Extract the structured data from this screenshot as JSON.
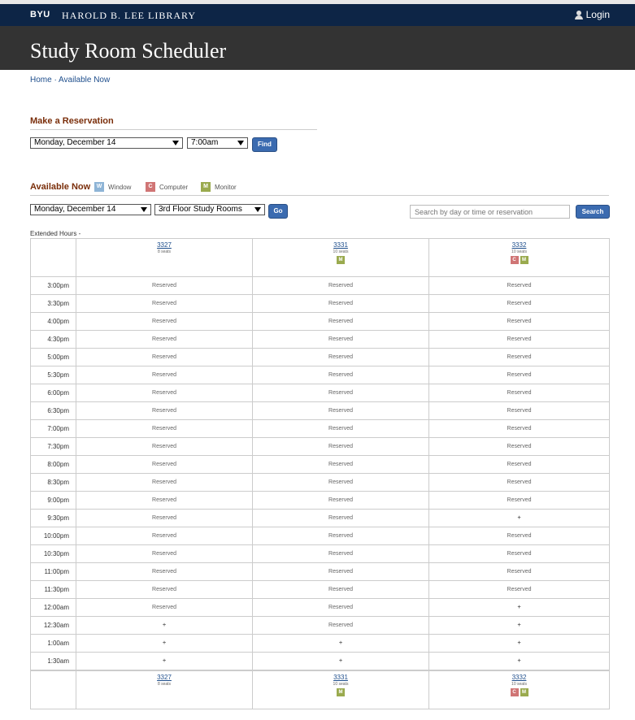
{
  "header": {
    "brand": "BYU",
    "library": "HAROLD B. LEE LIBRARY",
    "login": "Login"
  },
  "title": "Study Room Scheduler",
  "breadcrumb": {
    "home": "Home",
    "sep": " · ",
    "current": "Available Now"
  },
  "reservation": {
    "heading": "Make a Reservation",
    "date": "Monday, December 14",
    "time": "7:00am",
    "find": "Find"
  },
  "available": {
    "heading": "Available Now",
    "legend": [
      {
        "code": "W",
        "label": "Window",
        "color": "#8eb4d6"
      },
      {
        "code": "C",
        "label": "Computer",
        "color": "#d07575"
      },
      {
        "code": "M",
        "label": "Monitor",
        "color": "#9aaa4e"
      }
    ],
    "date": "Monday, December 14",
    "location": "3rd Floor Study Rooms",
    "go": "Go",
    "search_placeholder": "Search by day or time or reservation",
    "search": "Search",
    "extended": "Extended Hours -"
  },
  "rooms": [
    {
      "number": "3327",
      "seats": "8 seats",
      "features": []
    },
    {
      "number": "3331",
      "seats": "10 seats",
      "features": [
        "M"
      ]
    },
    {
      "number": "3332",
      "seats": "10 seats",
      "features": [
        "C",
        "M"
      ]
    }
  ],
  "slots": [
    {
      "time": "3:00pm",
      "cells": [
        "Reserved",
        "Reserved",
        "Reserved"
      ]
    },
    {
      "time": "3:30pm",
      "cells": [
        "Reserved",
        "Reserved",
        "Reserved"
      ]
    },
    {
      "time": "4:00pm",
      "cells": [
        "Reserved",
        "Reserved",
        "Reserved"
      ]
    },
    {
      "time": "4:30pm",
      "cells": [
        "Reserved",
        "Reserved",
        "Reserved"
      ]
    },
    {
      "time": "5:00pm",
      "cells": [
        "Reserved",
        "Reserved",
        "Reserved"
      ]
    },
    {
      "time": "5:30pm",
      "cells": [
        "Reserved",
        "Reserved",
        "Reserved"
      ]
    },
    {
      "time": "6:00pm",
      "cells": [
        "Reserved",
        "Reserved",
        "Reserved"
      ]
    },
    {
      "time": "6:30pm",
      "cells": [
        "Reserved",
        "Reserved",
        "Reserved"
      ]
    },
    {
      "time": "7:00pm",
      "cells": [
        "Reserved",
        "Reserved",
        "Reserved"
      ]
    },
    {
      "time": "7:30pm",
      "cells": [
        "Reserved",
        "Reserved",
        "Reserved"
      ]
    },
    {
      "time": "8:00pm",
      "cells": [
        "Reserved",
        "Reserved",
        "Reserved"
      ]
    },
    {
      "time": "8:30pm",
      "cells": [
        "Reserved",
        "Reserved",
        "Reserved"
      ]
    },
    {
      "time": "9:00pm",
      "cells": [
        "Reserved",
        "Reserved",
        "Reserved"
      ]
    },
    {
      "time": "9:30pm",
      "cells": [
        "Reserved",
        "Reserved",
        "+"
      ]
    },
    {
      "time": "10:00pm",
      "cells": [
        "Reserved",
        "Reserved",
        "Reserved"
      ]
    },
    {
      "time": "10:30pm",
      "cells": [
        "Reserved",
        "Reserved",
        "Reserved"
      ]
    },
    {
      "time": "11:00pm",
      "cells": [
        "Reserved",
        "Reserved",
        "Reserved"
      ]
    },
    {
      "time": "11:30pm",
      "cells": [
        "Reserved",
        "Reserved",
        "Reserved"
      ]
    },
    {
      "time": "12:00am",
      "cells": [
        "Reserved",
        "Reserved",
        "+"
      ]
    },
    {
      "time": "12:30am",
      "cells": [
        "+",
        "Reserved",
        "+"
      ]
    },
    {
      "time": "1:00am",
      "cells": [
        "+",
        "+",
        "+"
      ]
    },
    {
      "time": "1:30am",
      "cells": [
        "+",
        "+",
        "+"
      ]
    }
  ]
}
